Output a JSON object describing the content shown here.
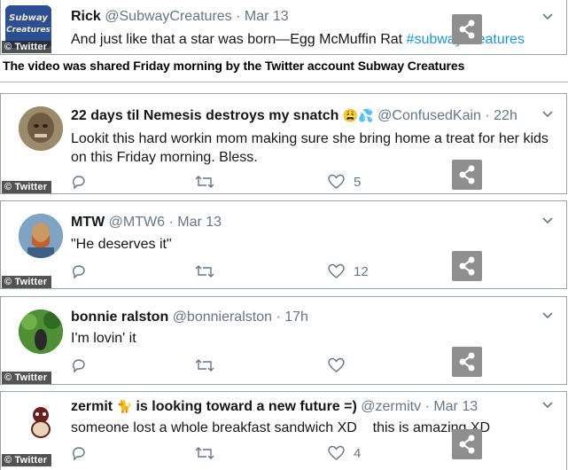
{
  "watermark": "© Twitter",
  "caption": "The video was shared Friday morning by the Twitter account Subway Creatures",
  "tweets": [
    {
      "name": "Rick",
      "handle": "@SubwayCreatures",
      "sep": "·",
      "time": "Mar 13",
      "text_plain": "And just like that a star was born—Egg McMuffin Rat ",
      "hashtag": "#subwayCreatures",
      "avatar_text": "Subway Creatures"
    },
    {
      "name": "22 days til Nemesis destroys my snatch",
      "emoji": "😩💦",
      "handle": "@ConfusedKain",
      "sep": "·",
      "time": "22h",
      "text": "Lookit this hard workin mom making sure she bring home a treat for her kids on this Friday morning. Bless.",
      "likes": "5"
    },
    {
      "name": "MTW",
      "handle": "@MTW6",
      "sep": "·",
      "time": "Mar 13",
      "text": "\"He deserves it\"",
      "likes": "12"
    },
    {
      "name": "bonnie ralston",
      "handle": "@bonnieralston",
      "sep": "·",
      "time": "17h",
      "text": "I'm lovin' it",
      "likes": ""
    },
    {
      "name": "zermit",
      "emoji": "🐈",
      "name_suffix": " is looking toward a new future =)",
      "handle": "@zermitv",
      "sep": "·",
      "time": "Mar 13",
      "text": "someone lost a whole breakfast sandwich XD    this is amazing XD",
      "likes": "4"
    }
  ]
}
